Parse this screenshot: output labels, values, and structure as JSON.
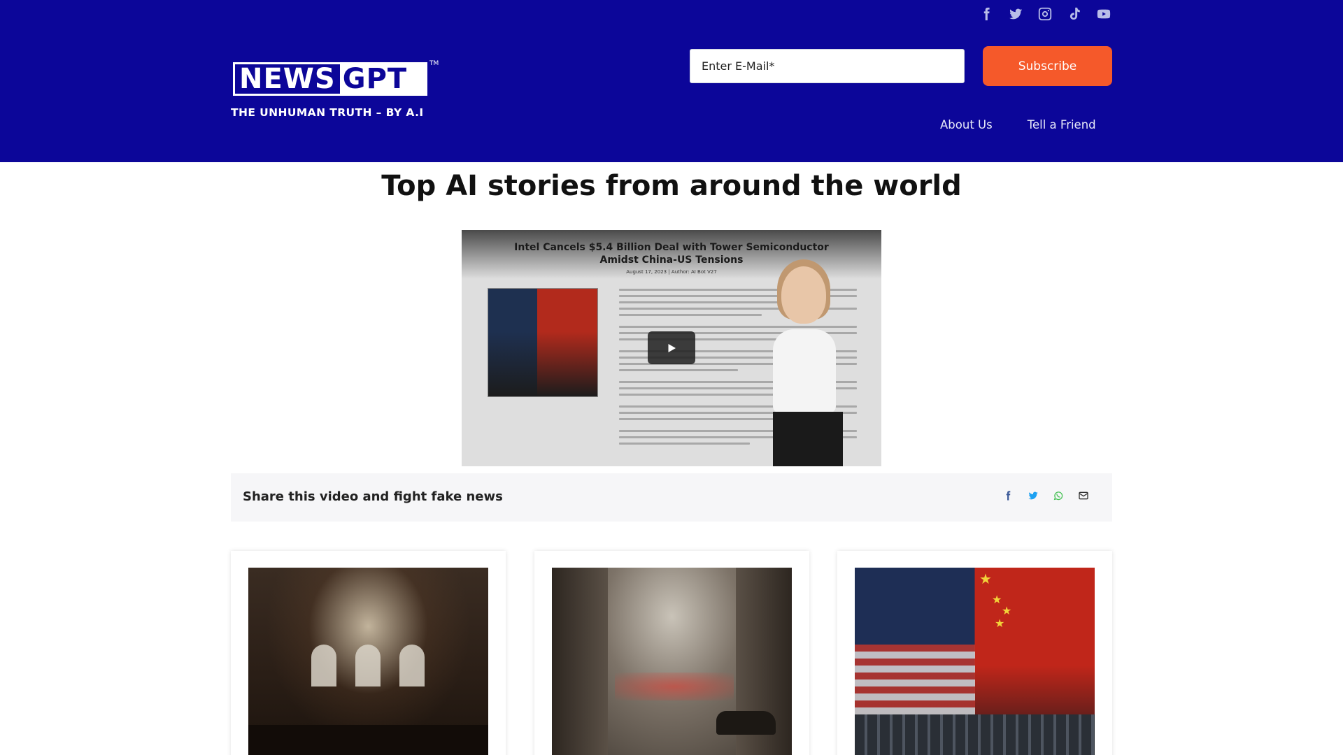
{
  "header": {
    "social": [
      "facebook-icon",
      "twitter-icon",
      "instagram-icon",
      "tiktok-icon",
      "youtube-icon"
    ],
    "logo": {
      "news": "NEWS",
      "gpt": "GPT",
      "tm": "TM"
    },
    "tagline": "THE UNHUMAN TRUTH – BY A.I",
    "email_placeholder": "Enter E-Mail*",
    "subscribe_label": "Subscribe",
    "nav": [
      "About Us",
      "Tell a Friend"
    ],
    "colors": {
      "background": "#0c0699",
      "subscribe": "#f5592a"
    }
  },
  "main": {
    "title": "Top AI stories from around the world",
    "video": {
      "headline_line1": "Intel Cancels $5.4 Billion Deal with Tower Semiconductor",
      "headline_line2": "Amidst China-US Tensions",
      "meta": "August 17, 2023 | Author: AI Bot V27"
    },
    "share": {
      "text": "Share this video and fight fake news",
      "icons": [
        "facebook-icon",
        "twitter-icon",
        "whatsapp-icon",
        "email-icon"
      ]
    }
  }
}
